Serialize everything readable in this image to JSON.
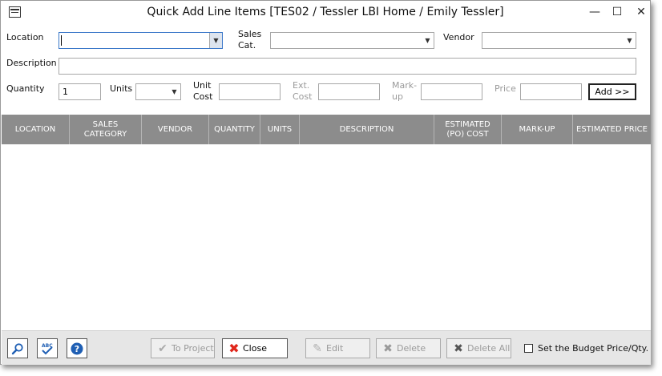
{
  "window": {
    "title": "Quick Add Line Items [TES02 / Tessler LBI Home / Emily Tessler]",
    "minimize_glyph": "—",
    "maximize_glyph": "☐",
    "close_glyph": "✕"
  },
  "form": {
    "location_label": "Location",
    "location_value": "",
    "sales_cat_label_1": "Sales",
    "sales_cat_label_2": "Cat.",
    "sales_cat_value": "",
    "vendor_label": "Vendor",
    "vendor_value": "",
    "description_label": "Description",
    "description_value": "",
    "quantity_label": "Quantity",
    "quantity_value": "1",
    "units_label": "Units",
    "units_value": "",
    "unit_cost_label_1": "Unit",
    "unit_cost_label_2": "Cost",
    "unit_cost_value": "",
    "ext_cost_label_1": "Ext.",
    "ext_cost_label_2": "Cost",
    "ext_cost_value": "",
    "markup_label_1": "Mark-",
    "markup_label_2": "up",
    "markup_value": "",
    "price_label": "Price",
    "price_value": "",
    "add_button": "Add >>"
  },
  "grid": {
    "columns": [
      "LOCATION",
      "SALES\nCATEGORY",
      "VENDOR",
      "QUANTITY",
      "UNITS",
      "DESCRIPTION",
      "ESTIMATED\n(PO) COST",
      "MARK-UP",
      "ESTIMATED PRICE"
    ],
    "rows": []
  },
  "footer": {
    "to_project": "To Project",
    "close": "Close",
    "edit": "Edit",
    "delete": "Delete",
    "delete_all": "Delete All",
    "budget_checkbox_label": "Set the Budget Price/Qty.",
    "budget_checked": false
  },
  "colors": {
    "grid_header_bg": "#8c8c8c",
    "close_icon": "#e0261b",
    "help_icon": "#1f5fb4",
    "focus_border": "#3b78c9"
  }
}
